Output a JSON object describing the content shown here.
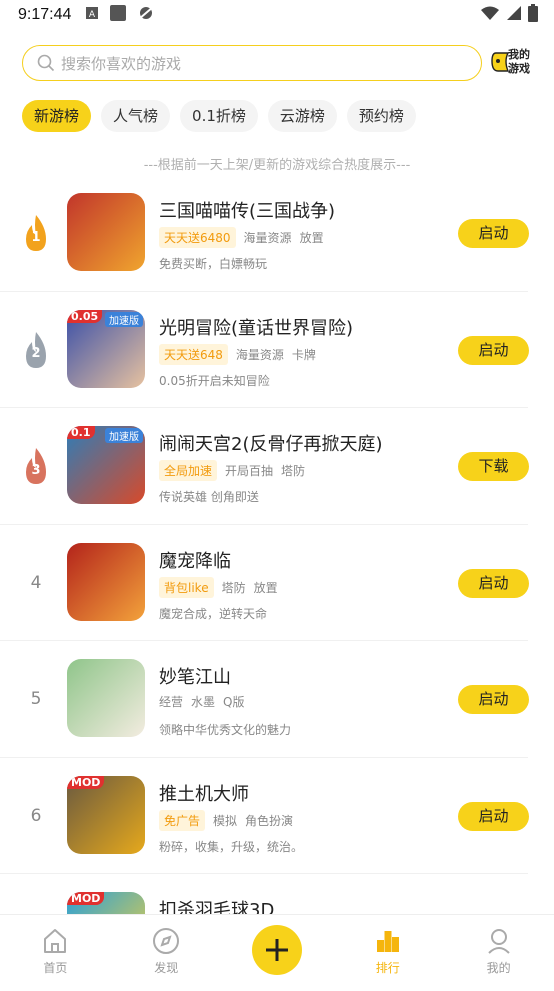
{
  "status": {
    "time": "9:17:44"
  },
  "search": {
    "placeholder": "搜索你喜欢的游戏",
    "my_games_label": "我的游戏"
  },
  "tabs": [
    {
      "label": "新游榜",
      "active": true
    },
    {
      "label": "人气榜",
      "active": false
    },
    {
      "label": "0.1折榜",
      "active": false
    },
    {
      "label": "云游榜",
      "active": false
    },
    {
      "label": "预约榜",
      "active": false
    }
  ],
  "note": "---根据前一天上架/更新的游戏综合热度展示---",
  "games": [
    {
      "rank": "1",
      "title": "三国喵喵传(三国战争)",
      "highlight": "天天送6480",
      "tags": [
        "海量资源",
        "放置"
      ],
      "desc": "免费买断，白嫖畅玩",
      "action": "启动",
      "icon_colors": [
        "#c1352b",
        "#f0a52e"
      ],
      "corner": "",
      "speed": ""
    },
    {
      "rank": "2",
      "title": "光明冒险(童话世界冒险)",
      "highlight": "天天送648",
      "tags": [
        "海量资源",
        "卡牌"
      ],
      "desc": "0.05折开启未知冒险",
      "action": "启动",
      "icon_colors": [
        "#3a4fa8",
        "#e7c2a0"
      ],
      "corner": "0.05",
      "speed": "加速版"
    },
    {
      "rank": "3",
      "title": "闹闹天宫2(反骨仔再掀天庭)",
      "highlight": "全局加速",
      "tags": [
        "开局百抽",
        "塔防"
      ],
      "desc": "传说英雄 创角即送",
      "action": "下载",
      "icon_colors": [
        "#2e7db8",
        "#d84a2a"
      ],
      "corner": "0.1",
      "speed": "加速版"
    },
    {
      "rank": "4",
      "title": "魔宠降临",
      "highlight": "背包like",
      "tags": [
        "塔防",
        "放置"
      ],
      "desc": "魔宠合成，逆转天命",
      "action": "启动",
      "icon_colors": [
        "#b3231b",
        "#f3a23b"
      ],
      "corner": "",
      "speed": ""
    },
    {
      "rank": "5",
      "title": "妙笔江山",
      "highlight": "",
      "tags": [
        "经营",
        "水墨",
        "Q版"
      ],
      "desc": "领略中华优秀文化的魅力",
      "action": "启动",
      "icon_colors": [
        "#8fc58a",
        "#f3ece0"
      ],
      "corner": "",
      "speed": ""
    },
    {
      "rank": "6",
      "title": "推土机大师",
      "highlight": "免广告",
      "tags": [
        "模拟",
        "角色扮演"
      ],
      "desc": "粉碎，收集，升级，统治。",
      "action": "启动",
      "icon_colors": [
        "#6a5a40",
        "#e6a91c"
      ],
      "corner": "MOD",
      "speed": ""
    },
    {
      "rank": "",
      "title": "扣杀羽毛球3D",
      "highlight": "",
      "tags": [],
      "desc": "",
      "action": "",
      "icon_colors": [
        "#2aa0d8",
        "#f6d23a"
      ],
      "corner": "MOD",
      "speed": ""
    }
  ],
  "nav": [
    {
      "label": "首页",
      "icon": "home-icon"
    },
    {
      "label": "发现",
      "icon": "compass-icon"
    },
    {
      "label": "",
      "icon": "plus-icon"
    },
    {
      "label": "排行",
      "icon": "ranking-icon"
    },
    {
      "label": "我的",
      "icon": "user-icon"
    }
  ],
  "colors": {
    "accent": "#f7d21a",
    "highlight_text": "#f29b0e",
    "gold": "#f2a21d",
    "silver": "#9aa3ad",
    "bronze": "#d8735e"
  }
}
